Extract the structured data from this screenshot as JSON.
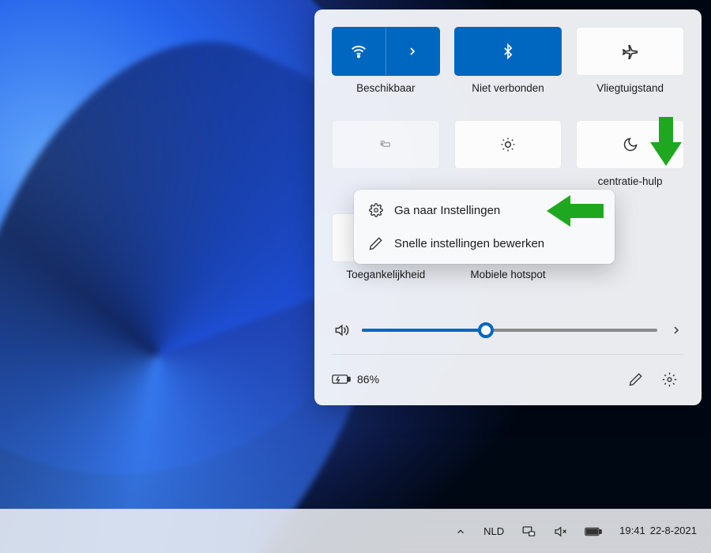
{
  "tiles": {
    "wifi": {
      "label": "Beschikbaar",
      "active": true
    },
    "bluetooth": {
      "label": "Niet verbonden",
      "active": true
    },
    "airplane": {
      "label": "Vliegtuigstand",
      "active": false
    },
    "battery_saver": {
      "label": "",
      "active": false
    },
    "brightness": {
      "label": "",
      "active": false
    },
    "night_light": {
      "label": "centratie-hulp",
      "active": false
    },
    "accessibility": {
      "label": "Toegankelijkheid",
      "active": false
    },
    "hotspot": {
      "label": "Mobiele hotspot",
      "active": false
    }
  },
  "context_menu": {
    "settings": "Ga naar Instellingen",
    "edit": "Snelle instellingen bewerken"
  },
  "slider": {
    "value": 42
  },
  "battery": {
    "text": "86%"
  },
  "taskbar": {
    "lang": "NLD",
    "time": "19:41",
    "date": "22-8-2021"
  },
  "colors": {
    "accent": "#0067c0",
    "arrow": "#1fa81f"
  }
}
